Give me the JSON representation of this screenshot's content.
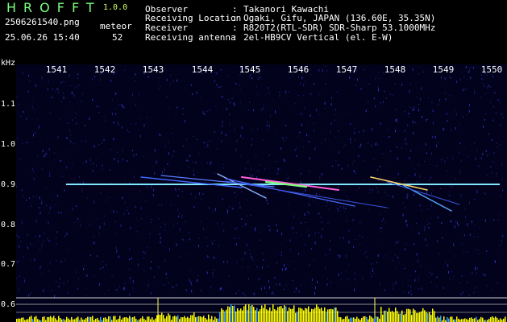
{
  "header": {
    "app_title": "HROFFT",
    "version": "1.0.0",
    "filename": "2506261540.png",
    "detection_type": "meteor",
    "datetime": "25.06.26 15:40",
    "count": "52"
  },
  "info": {
    "observer_key": "Observer",
    "observer_val": "Takanori Kawachi",
    "location_key": "Receiving Location",
    "location_val": "Ogaki, Gifu, JAPAN (136.60E, 35.35N)",
    "receiver_key": "Receiver",
    "receiver_val": "R820T2(RTL-SDR) SDR-Sharp 53.1000MHz",
    "antenna_key": "Receiving antenna",
    "antenna_val": "2el-HB9CV Vertical (el. E-W)",
    "separator": ":"
  },
  "axes": {
    "y_unit": "kHz",
    "x_ticks": [
      "1541",
      "1542",
      "1543",
      "1544",
      "1545",
      "1546",
      "1547",
      "1548",
      "1549",
      "1550"
    ],
    "y_ticks": [
      "1.1",
      "1.0",
      "0.9",
      "0.8",
      "0.7",
      "0.6"
    ]
  },
  "colors": {
    "background": "#000000",
    "plot_bg": "#02021c",
    "title_green": "#7CFF7C",
    "signal_cyan": "#7FE8FF",
    "level_yellow": "#FFFF00",
    "text": "#FFFFFF"
  }
}
